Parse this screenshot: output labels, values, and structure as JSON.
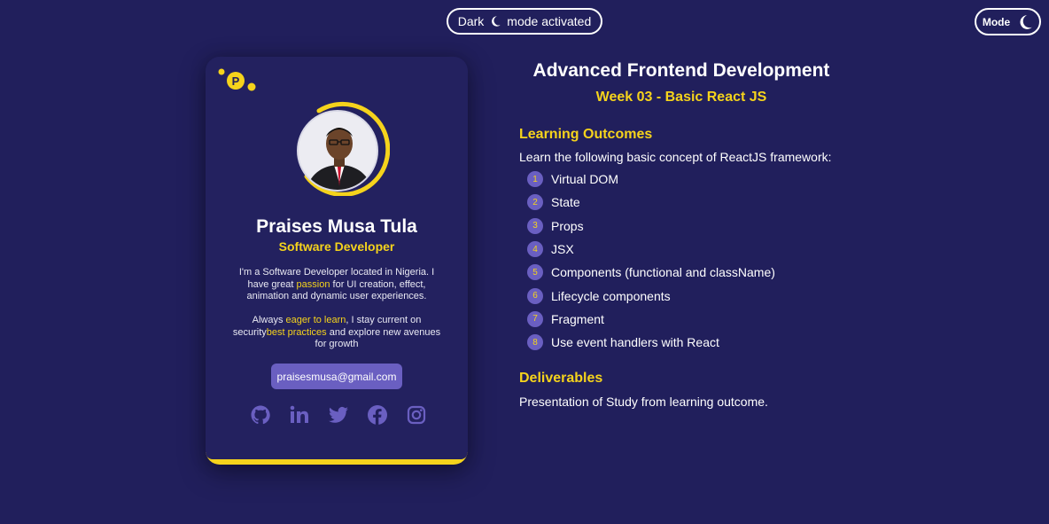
{
  "header": {
    "status_left": "Dark",
    "status_right": "mode activated",
    "mode_label": "Mode",
    "status_icon": "moon-icon",
    "mode_icon": "moon-icon"
  },
  "profile": {
    "logo_letter": "P",
    "name": "Praises Musa Tula",
    "role": "Software Developer",
    "bio1": {
      "a": "I'm a Software Developer located in Nigeria. I have great ",
      "hl": "passion",
      "b": " for UI creation, effect, animation and dynamic user experiences."
    },
    "bio2": {
      "a": "Always ",
      "hl1": "eager to learn",
      "b": ", I stay current on security",
      "hl2": "best practices",
      "c": " and explore new avenues for growth"
    },
    "email": "praisesmusa@gmail.com",
    "socials": [
      "github-icon",
      "linkedin-icon",
      "twitter-icon",
      "facebook-icon",
      "instagram-icon"
    ]
  },
  "course": {
    "title": "Advanced Frontend Development",
    "week": "Week 03 - Basic React JS",
    "learning_heading": "Learning Outcomes",
    "intro": "Learn the following basic concept of ReactJS framework:",
    "outcomes": [
      {
        "num": "1",
        "text": "Virtual DOM"
      },
      {
        "num": "2",
        "text": "State"
      },
      {
        "num": "3",
        "text": "Props"
      },
      {
        "num": "4",
        "text": "JSX"
      },
      {
        "num": "5",
        "text": "Components (functional and className)"
      },
      {
        "num": "6",
        "text": "Lifecycle components"
      },
      {
        "num": "7",
        "text": "Fragment"
      },
      {
        "num": "8",
        "text": "Use event handlers with React"
      }
    ],
    "deliverables_heading": "Deliverables",
    "deliverables_text": "Presentation of Study from learning outcome."
  },
  "colors": {
    "background": "#211f5c",
    "accent": "#f5d31c",
    "purple": "#6a5fc1"
  }
}
